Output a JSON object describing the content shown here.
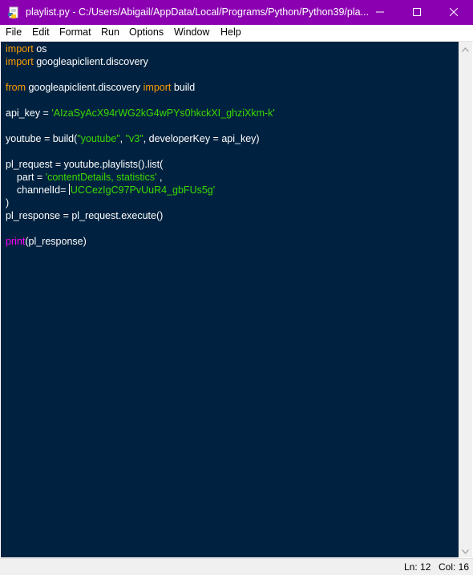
{
  "window": {
    "title": "playlist.py - C:/Users/Abigail/AppData/Local/Programs/Python/Python39/pla...",
    "accent_color": "#8b00b0"
  },
  "menu": [
    "File",
    "Edit",
    "Format",
    "Run",
    "Options",
    "Window",
    "Help"
  ],
  "editor": {
    "background": "#002240",
    "code": {
      "l1": {
        "kw": "import",
        "rest": " os"
      },
      "l2": {
        "kw": "import",
        "rest": " googleapiclient.discovery"
      },
      "l4": {
        "kw1": "from",
        "mid": " googleapiclient.discovery ",
        "kw2": "import",
        "rest": " build"
      },
      "l6": {
        "pre": "api_key = ",
        "str": "'AIzaSyAcX94rWG2kG4wPYs0hkckXI_ghziXkm-k'"
      },
      "l8": {
        "pre": "youtube = build(",
        "s1": "\"youtube\"",
        "sep": ", ",
        "s2": "\"v3\"",
        "post": ", developerKey = api_key)"
      },
      "l10": {
        "text": "pl_request = youtube.playlists().list("
      },
      "l11": {
        "pre": "    part = ",
        "str": "'contentDetails, statistics'",
        "post": " ,"
      },
      "l12": {
        "pre": "    channelId= ",
        "str": "UCCezIgC97PvUuR4_gbFUs5g'"
      },
      "l13": {
        "text": ")"
      },
      "l14": {
        "text": "pl_response = pl_request.execute()"
      },
      "l16": {
        "bi": "print",
        "rest": "(pl_response)"
      }
    }
  },
  "status": {
    "line": "Ln: 12",
    "col": "Col: 16"
  },
  "icons": {
    "app": "python-idle-icon",
    "minimize": "minimize-icon",
    "maximize": "maximize-icon",
    "close": "close-icon"
  }
}
